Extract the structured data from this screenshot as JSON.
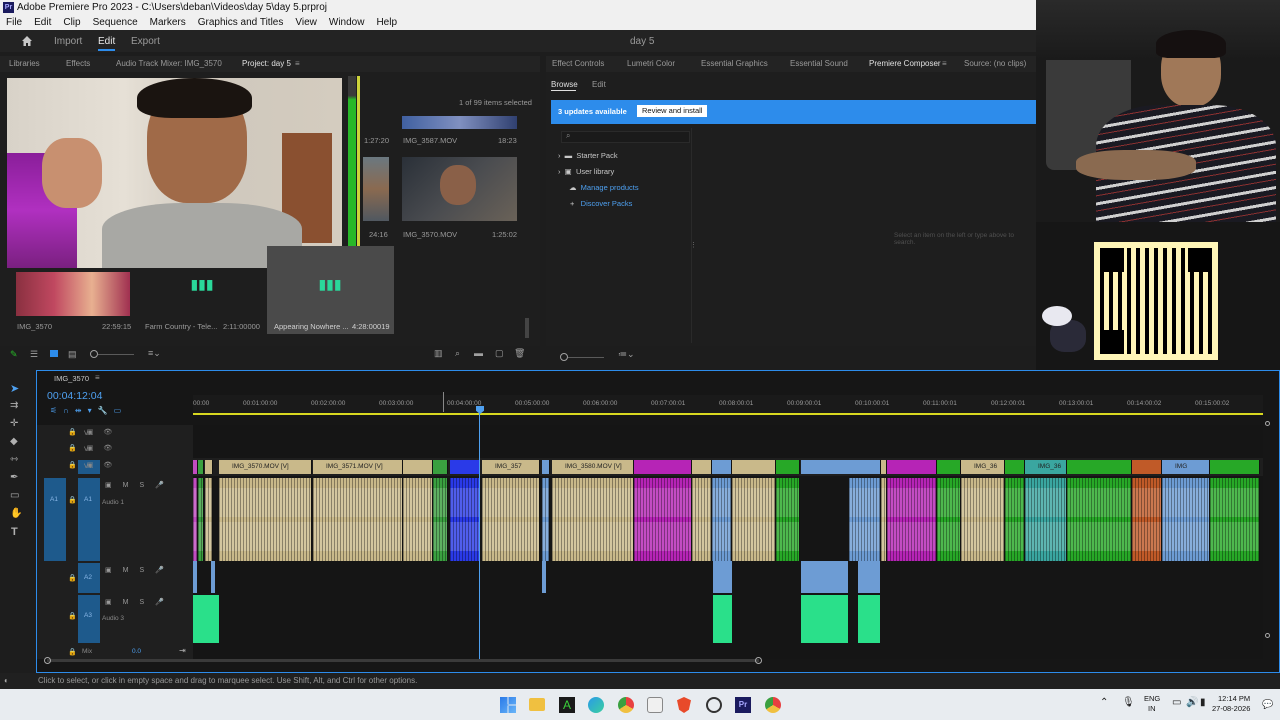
{
  "window": {
    "title": "Adobe Premiere Pro 2023 - C:\\Users\\deban\\Videos\\day 5\\day 5.prproj",
    "app_icon": "Pr"
  },
  "menu": [
    "File",
    "Edit",
    "Clip",
    "Sequence",
    "Markers",
    "Graphics and Titles",
    "View",
    "Window",
    "Help"
  ],
  "workspace": {
    "tabs": [
      "Import",
      "Edit",
      "Export"
    ],
    "active": "Edit",
    "project_title": "day 5"
  },
  "left_panel": {
    "tabs": [
      "Libraries",
      "Effects",
      "Audio Track Mixer: IMG_3570",
      "Project: day 5"
    ],
    "selection_info": "1 of 99 items selected",
    "items": [
      {
        "name": "",
        "duration": "1:27:20"
      },
      {
        "name": "IMG_3587.MOV",
        "duration": "18:23"
      },
      {
        "name": "",
        "duration": "24:16"
      },
      {
        "name": "IMG_3570.MOV",
        "duration": "1:25:02"
      },
      {
        "name": "IMG_3570",
        "duration": "22:59:15"
      },
      {
        "name": "Farm Country - Tele...",
        "duration": "2:11:00000"
      },
      {
        "name": "Appearing Nowhere ...",
        "duration": "4:28:00019"
      }
    ]
  },
  "right_panel": {
    "tabs": [
      "Effect Controls",
      "Lumetri Color",
      "Essential Graphics",
      "Essential Sound",
      "Premiere Composer",
      "Source: (no clips)"
    ],
    "subtabs": [
      "Browse",
      "Edit"
    ],
    "banner": {
      "text": "3 updates available",
      "button": "Review and install"
    },
    "tree": [
      "Starter Pack",
      "User library",
      "Manage products",
      "Discover Packs"
    ],
    "hint": "Select an item on the left or type above to search."
  },
  "timeline": {
    "sequence": "IMG_3570",
    "timecode": "00:04:12:04",
    "ruler": [
      "00:00",
      "00:01:00:00",
      "00:02:00:00",
      "00:03:00:00",
      "00:04:00:00",
      "00:05:00:00",
      "00:06:00:00",
      "00:07:00:01",
      "00:08:00:01",
      "00:09:00:01",
      "00:10:00:01",
      "00:11:00:01",
      "00:12:00:01",
      "00:13:00:01",
      "00:14:00:02",
      "00:15:00:02"
    ],
    "tracks": {
      "v3": "V3",
      "v2": "V2",
      "v1": "V1",
      "a1": "A1",
      "a1_name": "Audio 1",
      "a2": "A2",
      "a3": "A3",
      "a3_name": "Audio 3",
      "mix": "Mix",
      "mix_value": "0.0"
    },
    "clips_v1": [
      "IMG_3570.MOV [V]",
      "IMG_3571.MOV [V]",
      "IMG_357",
      "IMG_3580.MOV [V]",
      "IMG_36",
      "IMG_36",
      "IMG"
    ]
  },
  "status": "Click to select, or click in empty space and drag to marquee select. Use Shift, Alt, and Ctrl for other options.",
  "taskbar": {
    "lang1": "ENG",
    "lang2": "IN",
    "time": "12:14 PM",
    "date": "27-08-2026"
  },
  "colors": {
    "accent_blue": "#2d8ceb",
    "clip_tan": "#c9b98a",
    "clip_magenta": "#b624b6",
    "clip_green": "#27a827",
    "clip_teal": "#3aa6a0",
    "clip_blue": "#6d9cd4"
  }
}
